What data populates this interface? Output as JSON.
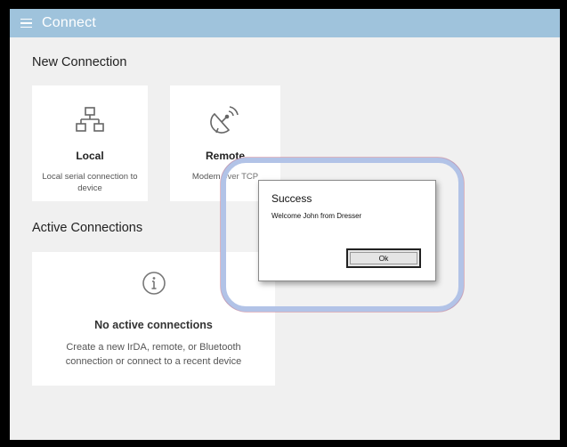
{
  "app": {
    "title": "Connect"
  },
  "new_connection": {
    "heading": "New Connection",
    "cards": [
      {
        "title": "Local",
        "description": "Local serial connection to device",
        "icon": "network-icon"
      },
      {
        "title": "Remote",
        "description": "Modem over TCP",
        "icon": "satellite-dish-icon"
      }
    ]
  },
  "active_connections": {
    "heading": "Active Connections",
    "empty_title": "No active connections",
    "empty_description": "Create a new IrDA, remote, or Bluetooth connection or connect to a recent device",
    "icon": "info-icon"
  },
  "dialog": {
    "title": "Success",
    "message": "Welcome John from Dresser",
    "ok_label": "Ok"
  },
  "colors": {
    "titlebar": "#9fc3dc",
    "highlight": "#b2c3e7",
    "background": "#f0f0f0"
  }
}
